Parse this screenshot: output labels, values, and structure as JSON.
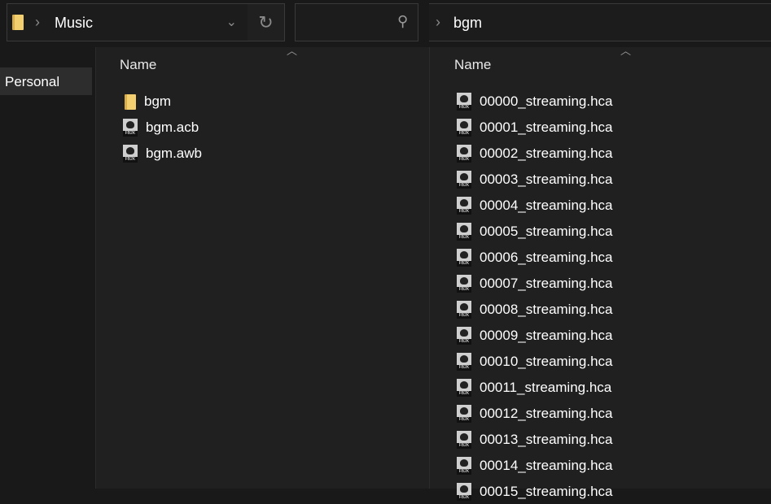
{
  "left_window": {
    "address": {
      "crumbs": [
        "Music"
      ],
      "folder_icon": "folder-icon"
    },
    "search": {
      "placeholder": ""
    },
    "sidebar": {
      "items": [
        {
          "label": "Personal",
          "selected": true
        }
      ]
    },
    "column_header": "Name",
    "files": [
      {
        "name": "bgm",
        "type": "folder"
      },
      {
        "name": "bgm.acb",
        "type": "fb2k"
      },
      {
        "name": "bgm.awb",
        "type": "fb2k"
      }
    ]
  },
  "right_window": {
    "address": {
      "crumbs": [
        "bgm"
      ]
    },
    "column_header": "Name",
    "files": [
      "00000_streaming.hca",
      "00001_streaming.hca",
      "00002_streaming.hca",
      "00003_streaming.hca",
      "00004_streaming.hca",
      "00005_streaming.hca",
      "00006_streaming.hca",
      "00007_streaming.hca",
      "00008_streaming.hca",
      "00009_streaming.hca",
      "00010_streaming.hca",
      "00011_streaming.hca",
      "00012_streaming.hca",
      "00013_streaming.hca",
      "00014_streaming.hca",
      "00015_streaming.hca"
    ]
  }
}
